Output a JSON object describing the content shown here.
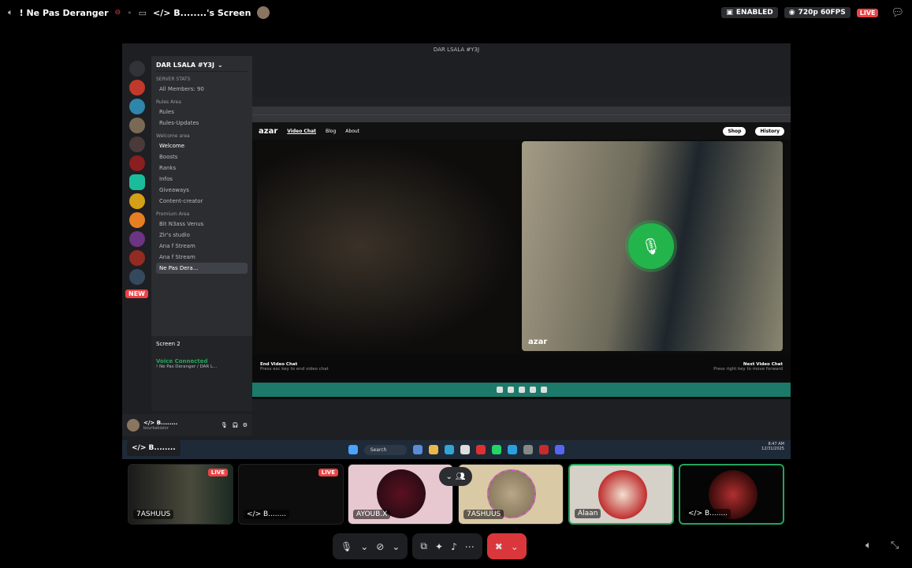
{
  "topbar": {
    "channel": "! Ne Pas Deranger",
    "screen_title": "</> B........'s Screen",
    "enabled_badge": "ENABLED",
    "quality": "720p 60FPS",
    "live": "LIVE"
  },
  "shared_screen": {
    "window_title": "DAR LSALA #Y3J",
    "discord": {
      "server_name": "DAR LSALA #Y3J",
      "categories": [
        {
          "name": "SERVER STATS",
          "channels": [
            "All Members: 90"
          ]
        },
        {
          "name": "Rules Area",
          "channels": [
            "Rules",
            "Rules-Updates"
          ]
        },
        {
          "name": "Welcome area",
          "channels": [
            "Welcome",
            "Boosts",
            "Ranks",
            "Infos",
            "Giveaways",
            "Content-creator"
          ]
        },
        {
          "name": "Premium Area",
          "channels": [
            "Bit N3ass Venus",
            "Zir's studio",
            "Ana f Stream",
            "Ana f Stream",
            "Ne Pas Dera..."
          ]
        }
      ],
      "new_badge": "NEW",
      "stream_name": "Screen 2",
      "voice_status": "Voice Connected",
      "voice_channel": "! Ne Pas Deranger / DAR L...",
      "user_name": "</> B........",
      "user_tag": "bourkabiator"
    },
    "azar": {
      "logo": "azar",
      "nav": [
        "Video Chat",
        "Blog",
        "About"
      ],
      "shop": "Shop",
      "history": "History",
      "watermark": "azar",
      "end_title": "End Video Chat",
      "end_hint": "Press esc key to end video chat",
      "next_title": "Next Video Chat",
      "next_hint": "Press right key to move forward"
    },
    "taskbar": {
      "search": "Search",
      "time": "8:47 AM",
      "date": "12/31/2025"
    },
    "name_tag": "</> B........"
  },
  "tiles": [
    {
      "label": "7ASHUUS",
      "live": "LIVE"
    },
    {
      "label": "</> B........",
      "live": "LIVE"
    },
    {
      "label": "AYOUB.X"
    },
    {
      "label": "7ASHUUS"
    },
    {
      "label": "Alaan"
    },
    {
      "label": "</> B........"
    }
  ],
  "icons": {
    "speaker": "speaker-icon",
    "mic": "mic-icon",
    "camera_off": "camera-off-icon",
    "screenshare": "screenshare-icon",
    "activities": "activities-icon",
    "soundboard": "soundboard-icon",
    "more": "more-icon",
    "leave": "leave-call-icon"
  },
  "colors": {
    "live": "#ed4245",
    "speaking": "#23a559",
    "leave": "#da373c",
    "azar_mic": "#23b54c"
  }
}
